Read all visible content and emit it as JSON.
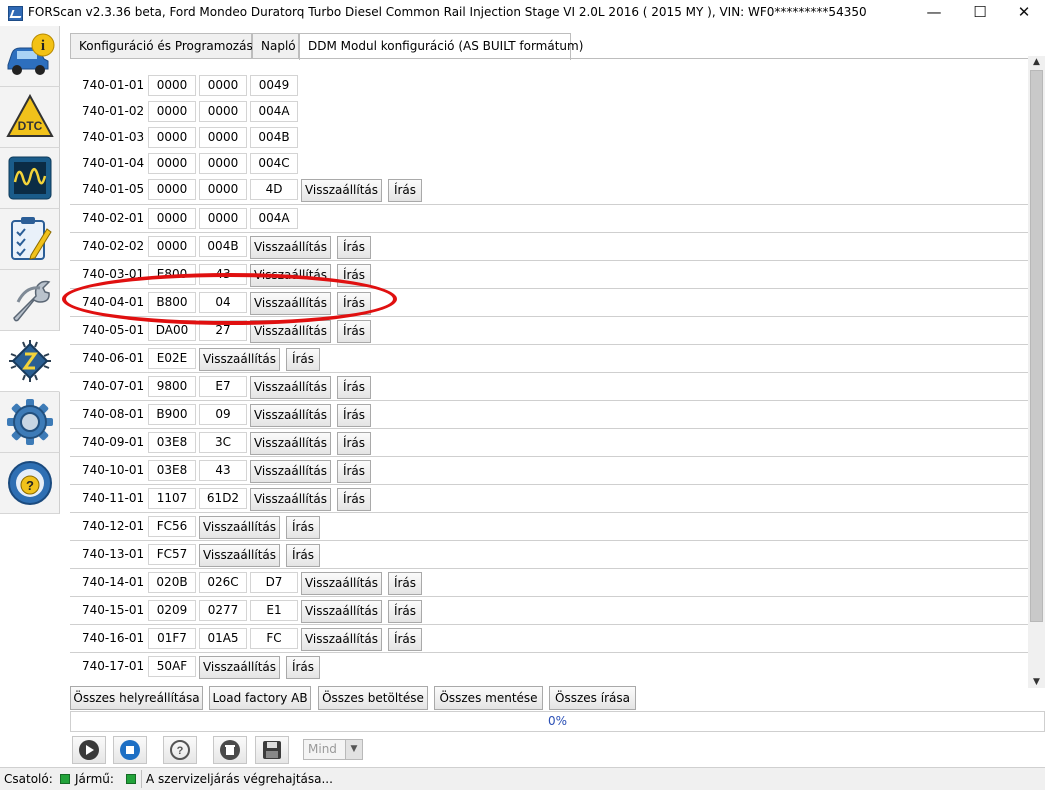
{
  "window": {
    "title": "FORScan v2.3.36 beta, Ford Mondeo Duratorq Turbo Diesel Common Rail Injection Stage VI 2.0L 2016 ( 2015 MY ), VIN: WF0*********54350",
    "minimize": "—",
    "maximize": "☐",
    "close": "✕"
  },
  "sidebar": {
    "items": [
      {
        "name": "vehicle-info",
        "icon": "car-info-icon"
      },
      {
        "name": "dtc",
        "icon": "dtc-warning-icon"
      },
      {
        "name": "oscilloscope",
        "icon": "oscilloscope-icon"
      },
      {
        "name": "tests",
        "icon": "checklist-icon"
      },
      {
        "name": "service",
        "icon": "wrench-icon"
      },
      {
        "name": "configuration",
        "icon": "chip-icon",
        "active": true
      },
      {
        "name": "settings",
        "icon": "gear-icon"
      },
      {
        "name": "help",
        "icon": "steering-help-icon"
      }
    ]
  },
  "tabs": [
    {
      "label": "Konfiguráció és Programozás"
    },
    {
      "label": "Napló"
    },
    {
      "label": "DDM Modul konfiguráció (AS BUILT formátum)"
    }
  ],
  "row_buttons": {
    "restore": "Visszaállítás",
    "write": "Írás"
  },
  "rows": [
    {
      "id": "740-01-01",
      "cells": [
        "0000",
        "0000",
        "0049"
      ],
      "buttons": false
    },
    {
      "id": "740-01-02",
      "cells": [
        "0000",
        "0000",
        "004A"
      ],
      "buttons": false
    },
    {
      "id": "740-01-03",
      "cells": [
        "0000",
        "0000",
        "004B"
      ],
      "buttons": false
    },
    {
      "id": "740-01-04",
      "cells": [
        "0000",
        "0000",
        "004C"
      ],
      "buttons": false
    },
    {
      "id": "740-01-05",
      "cells": [
        "0000",
        "0000",
        "4D"
      ],
      "buttons": true
    },
    {
      "id": "740-02-01",
      "cells": [
        "0000",
        "0000",
        "004A"
      ],
      "buttons": false
    },
    {
      "id": "740-02-02",
      "cells": [
        "0000",
        "004B"
      ],
      "buttons": true
    },
    {
      "id": "740-03-01",
      "cells": [
        "E800",
        "43"
      ],
      "buttons": true
    },
    {
      "id": "740-04-01",
      "cells": [
        "B800",
        "04"
      ],
      "buttons": true
    },
    {
      "id": "740-05-01",
      "cells": [
        "DA00",
        "27"
      ],
      "buttons": true
    },
    {
      "id": "740-06-01",
      "cells": [
        "E02E"
      ],
      "buttons": true
    },
    {
      "id": "740-07-01",
      "cells": [
        "9800",
        "E7"
      ],
      "buttons": true
    },
    {
      "id": "740-08-01",
      "cells": [
        "B900",
        "09"
      ],
      "buttons": true
    },
    {
      "id": "740-09-01",
      "cells": [
        "03E8",
        "3C"
      ],
      "buttons": true
    },
    {
      "id": "740-10-01",
      "cells": [
        "03E8",
        "43"
      ],
      "buttons": true
    },
    {
      "id": "740-11-01",
      "cells": [
        "1107",
        "61D2"
      ],
      "buttons": true
    },
    {
      "id": "740-12-01",
      "cells": [
        "FC56"
      ],
      "buttons": true
    },
    {
      "id": "740-13-01",
      "cells": [
        "FC57"
      ],
      "buttons": true
    },
    {
      "id": "740-14-01",
      "cells": [
        "020B",
        "026C",
        "D7"
      ],
      "buttons": true
    },
    {
      "id": "740-15-01",
      "cells": [
        "0209",
        "0277",
        "E1"
      ],
      "buttons": true
    },
    {
      "id": "740-16-01",
      "cells": [
        "01F7",
        "01A5",
        "FC"
      ],
      "buttons": true
    },
    {
      "id": "740-17-01",
      "cells": [
        "50AF"
      ],
      "buttons": true
    }
  ],
  "bottom_buttons": [
    "Összes helyreállítása",
    "Load factory AB",
    "Összes betöltése",
    "Összes mentése",
    "Összes írása"
  ],
  "progress": {
    "value": 0,
    "label": "0%"
  },
  "toolbar": {
    "buttons": [
      "play-icon",
      "stop-icon",
      "help-call-icon",
      "delete-icon",
      "save-icon"
    ],
    "select": {
      "value": "Mind"
    }
  },
  "statusbar": {
    "connector_label": "Csatoló:",
    "vehicle_label": "Jármű:",
    "message": "A szervizeljárás végrehajtása...",
    "connector_status_color": "#22a33a",
    "vehicle_status_color": "#22a33a"
  },
  "highlight": {
    "row": "740-04-01",
    "color": "#e01010"
  }
}
